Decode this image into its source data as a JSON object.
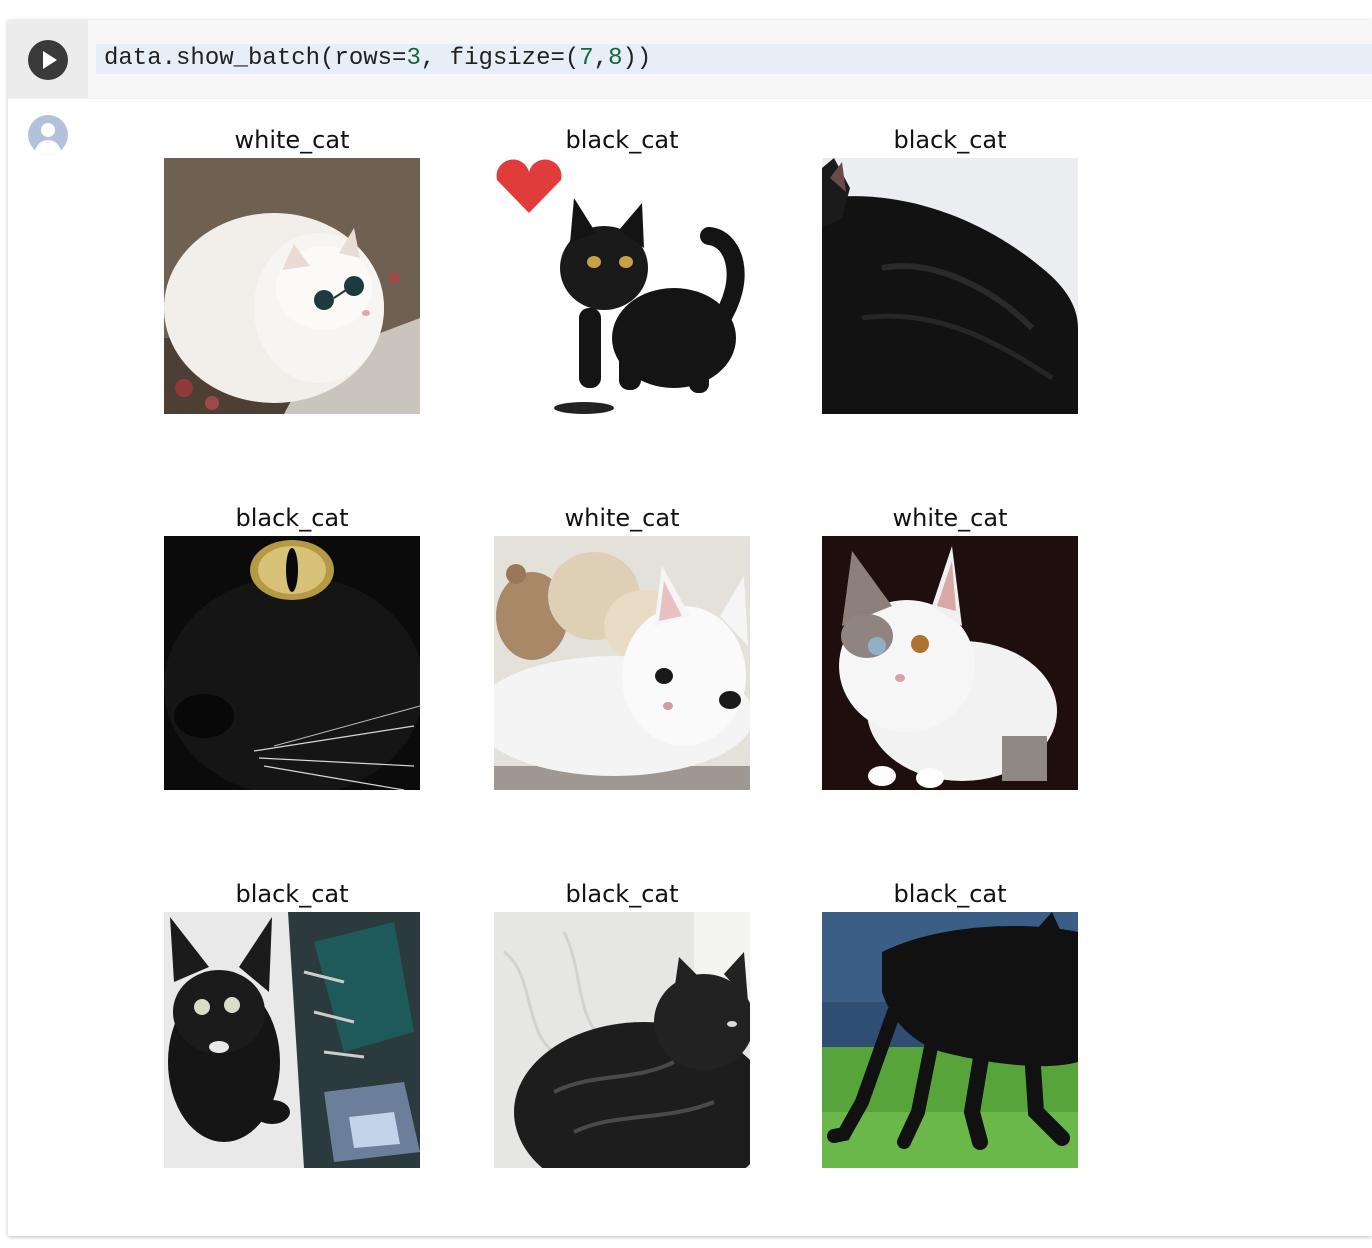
{
  "code_cell": {
    "code_before_3": "data.show_batch(rows=",
    "num_rows": "3",
    "code_between": ", figsize=(",
    "num_w": "7",
    "comma": ",",
    "num_h": "8",
    "code_end": "))"
  },
  "output": {
    "tiles": [
      {
        "label": "white_cat",
        "image": "white cat with sunglasses"
      },
      {
        "label": "black_cat",
        "image": "black kitten with red heart"
      },
      {
        "label": "black_cat",
        "image": "black cat lying down"
      },
      {
        "label": "black_cat",
        "image": "close-up black cat eye"
      },
      {
        "label": "white_cat",
        "image": "white cat with teddy bears"
      },
      {
        "label": "white_cat",
        "image": "white cat with odd eyes"
      },
      {
        "label": "black_cat",
        "image": "black kitten collage"
      },
      {
        "label": "black_cat",
        "image": "fluffy black cat"
      },
      {
        "label": "black_cat",
        "image": "black cat on grass"
      }
    ]
  },
  "colors": {
    "run_button": "#3a3a3a",
    "code_highlight": "#e8eef6",
    "number": "#116644",
    "avatar": "#b3c2dc"
  }
}
